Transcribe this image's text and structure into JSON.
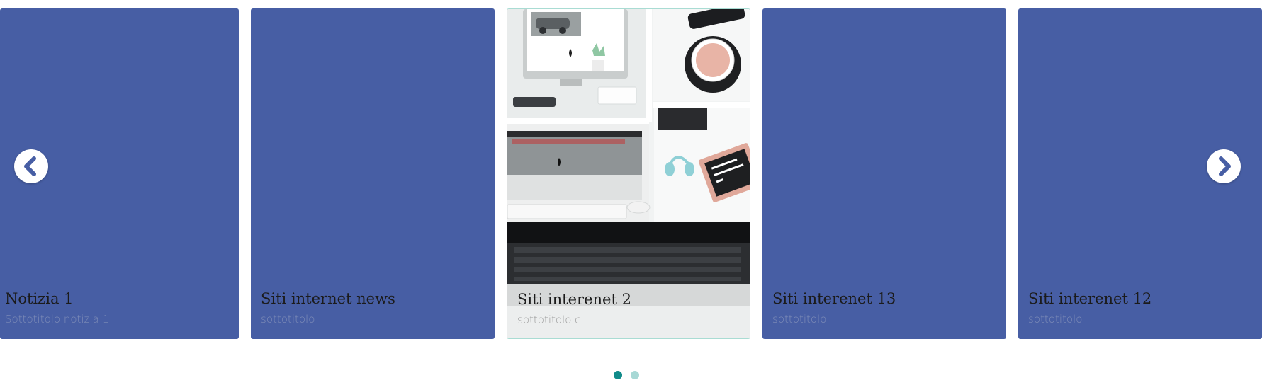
{
  "colors": {
    "card_bg": "#475ea4",
    "card_title": "#1b1b1b",
    "card_subtitle": "#7f8db8",
    "featured_border": "#a9dcd3",
    "dot_active": "#108b8a",
    "dot_inactive": "#a7d8d5",
    "nav_arrow": "#475ea4"
  },
  "carousel": {
    "prev_icon": "chevron-left-icon",
    "next_icon": "chevron-right-icon",
    "cards": [
      {
        "title": "Notizia 1",
        "subtitle": "Sottotitolo notizia 1"
      },
      {
        "title": "Siti internet news",
        "subtitle": "sottotitolo"
      },
      {
        "title": "Siti interenet 2",
        "subtitle": "sottotitolo c",
        "image": "desk-workspace-photo"
      },
      {
        "title": "Siti interenet 13",
        "subtitle": "sottotitolo"
      },
      {
        "title": "Siti interenet 12",
        "subtitle": "sottotitolo"
      }
    ],
    "pagination": {
      "pages": 2,
      "active_page": 1
    }
  }
}
